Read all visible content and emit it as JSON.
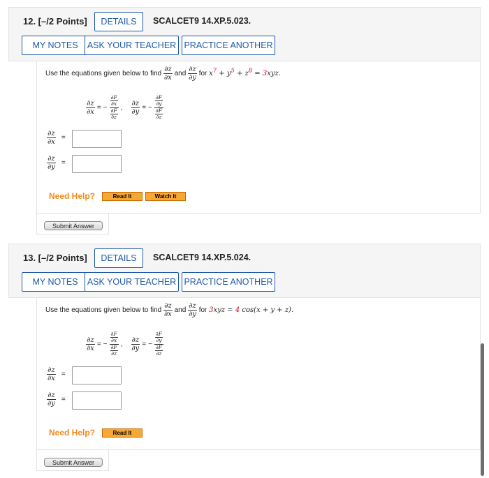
{
  "questions": [
    {
      "title": "12.  [–/2 Points]",
      "details_label": "DETAILS",
      "code": "SCALCET9 14.XP.5.023.",
      "my_notes_label": "MY NOTES",
      "ask_teacher_label": "ASK YOUR TEACHER",
      "practice_label": "PRACTICE ANOTHER",
      "prompt_prefix": "Use the equations given below to find",
      "prompt_and": "and",
      "prompt_for": "for",
      "equation_parts": [
        "x",
        "7",
        " + y",
        "5",
        " + z",
        "8",
        " = ",
        "3",
        "xyz."
      ],
      "need_help": "Need Help?",
      "read_it": "Read It",
      "watch_it": "Watch It",
      "submit": "Submit Answer"
    },
    {
      "title": "13.  [–/2 Points]",
      "details_label": "DETAILS",
      "code": "SCALCET9 14.XP.5.024.",
      "my_notes_label": "MY NOTES",
      "ask_teacher_label": "ASK YOUR TEACHER",
      "practice_label": "PRACTICE ANOTHER",
      "prompt_prefix": "Use the equations given below to find",
      "prompt_and": "and",
      "prompt_for": "for",
      "equation_parts": [
        "3",
        "xyz = ",
        "4",
        " cos(x + y + z)."
      ],
      "need_help": "Need Help?",
      "read_it": "Read It",
      "submit": "Submit Answer"
    }
  ],
  "symbols": {
    "dz": "∂z",
    "dx": "∂x",
    "dy": "∂y",
    "dF": "∂F",
    "eq": "=",
    "minus": "−",
    "comma": ","
  }
}
